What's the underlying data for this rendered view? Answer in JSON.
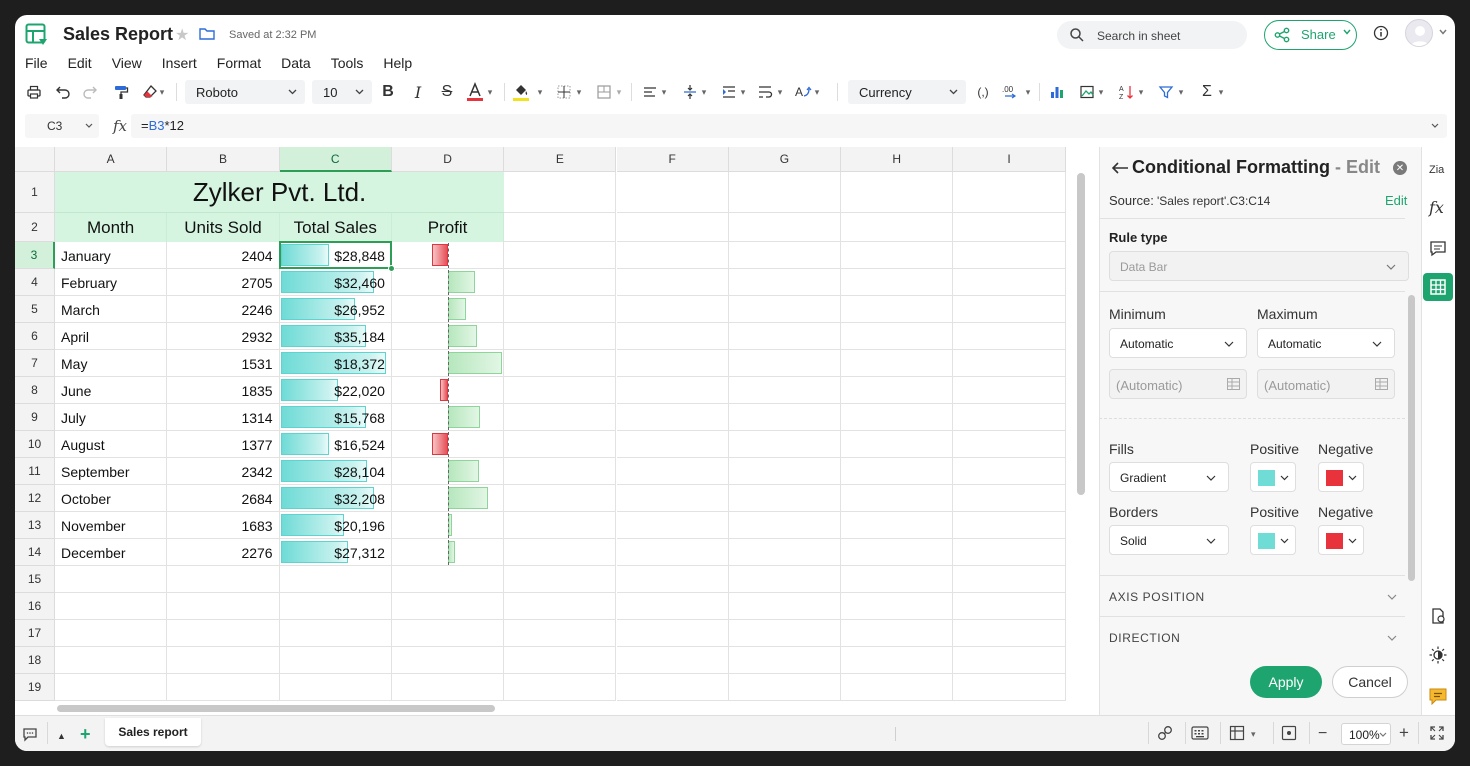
{
  "app": {
    "doc_title": "Sales Report",
    "saved_status": "Saved at 2:32 PM",
    "search_placeholder": "Search in sheet",
    "share_label": "Share"
  },
  "menu": [
    "File",
    "Edit",
    "View",
    "Insert",
    "Format",
    "Data",
    "Tools",
    "Help"
  ],
  "toolbar": {
    "font": "Roboto",
    "font_size": "10",
    "number_format": "Currency",
    "icons": [
      "print-icon",
      "undo-icon",
      "redo-icon",
      "paint-format-icon",
      "clear-format-icon",
      "bold-icon",
      "italic-icon",
      "strikethrough-icon",
      "text-color-icon",
      "fill-color-icon",
      "borders-icon",
      "merge-icon",
      "align-icon",
      "valign-icon",
      "indent-icon",
      "wrap-icon",
      "rotate-icon",
      "parentheses-icon",
      "decimal-icon",
      "chart-icon",
      "image-icon",
      "sort-icon",
      "filter-icon",
      "sum-icon"
    ]
  },
  "formula_bar": {
    "cell_ref": "C3",
    "formula_prefix": "=",
    "formula_ref": "B3",
    "formula_rest": "*12"
  },
  "sheet": {
    "columns": [
      "A",
      "B",
      "C",
      "D",
      "E",
      "F",
      "G",
      "H",
      "I"
    ],
    "rows": [
      "1",
      "2",
      "3",
      "4",
      "5",
      "6",
      "7",
      "8",
      "9",
      "10",
      "11",
      "12",
      "13",
      "14",
      "15",
      "16",
      "17",
      "18",
      "19"
    ],
    "title": "Zylker Pvt. Ltd.",
    "headers": [
      "Month",
      "Units Sold",
      "Total Sales",
      "Profit"
    ],
    "data": [
      {
        "month": "January",
        "units": "2404",
        "sales": "$28,848",
        "sales_fill": 0.45,
        "profit_fill": -0.48
      },
      {
        "month": "February",
        "units": "2705",
        "sales": "$32,460",
        "sales_fill": 0.86,
        "profit_fill": 0.5
      },
      {
        "month": "March",
        "units": "2246",
        "sales": "$26,952",
        "sales_fill": 0.69,
        "profit_fill": 0.34
      },
      {
        "month": "April",
        "units": "2932",
        "sales": "$35,184",
        "sales_fill": 0.79,
        "profit_fill": 0.54
      },
      {
        "month": "May",
        "units": "1531",
        "sales": "$18,372",
        "sales_fill": 0.97,
        "profit_fill": 1.0
      },
      {
        "month": "June",
        "units": "1835",
        "sales": "$22,020",
        "sales_fill": 0.53,
        "profit_fill": -0.22
      },
      {
        "month": "July",
        "units": "1314",
        "sales": "$15,768",
        "sales_fill": 0.79,
        "profit_fill": 0.6
      },
      {
        "month": "August",
        "units": "1377",
        "sales": "$16,524",
        "sales_fill": 0.45,
        "profit_fill": -0.48
      },
      {
        "month": "September",
        "units": "2342",
        "sales": "$28,104",
        "sales_fill": 0.8,
        "profit_fill": 0.57
      },
      {
        "month": "October",
        "units": "2684",
        "sales": "$32,208",
        "sales_fill": 0.86,
        "profit_fill": 0.74
      },
      {
        "month": "November",
        "units": "1683",
        "sales": "$20,196",
        "sales_fill": 0.59,
        "profit_fill": 0.06
      },
      {
        "month": "December",
        "units": "2276",
        "sales": "$27,312",
        "sales_fill": 0.62,
        "profit_fill": 0.14
      }
    ],
    "active_sheet_tab": "Sales report"
  },
  "panel": {
    "title": "Conditional Formatting",
    "title_suffix": "- Edit",
    "source_label": "Source:",
    "source_value": "'Sales report'.C3:C14",
    "source_edit": "Edit",
    "rule_type_label": "Rule type",
    "rule_type_value": "Data Bar",
    "minimum_label": "Minimum",
    "maximum_label": "Maximum",
    "minimum_value": "Automatic",
    "maximum_value": "Automatic",
    "minimum_input": "(Automatic)",
    "maximum_input": "(Automatic)",
    "fills_label": "Fills",
    "fills_value": "Gradient",
    "borders_label": "Borders",
    "borders_value": "Solid",
    "positive_label": "Positive",
    "negative_label": "Negative",
    "positive_color": "#6fdcd6",
    "negative_color": "#e8323c",
    "axis_position": "AXIS POSITION",
    "direction": "DIRECTION",
    "apply": "Apply",
    "cancel": "Cancel"
  },
  "status_bar": {
    "zoom": "100%"
  },
  "colors": {
    "accent": "#1ea56f",
    "header_fill": "#d6f5e1",
    "selection": "#2e9e57"
  }
}
